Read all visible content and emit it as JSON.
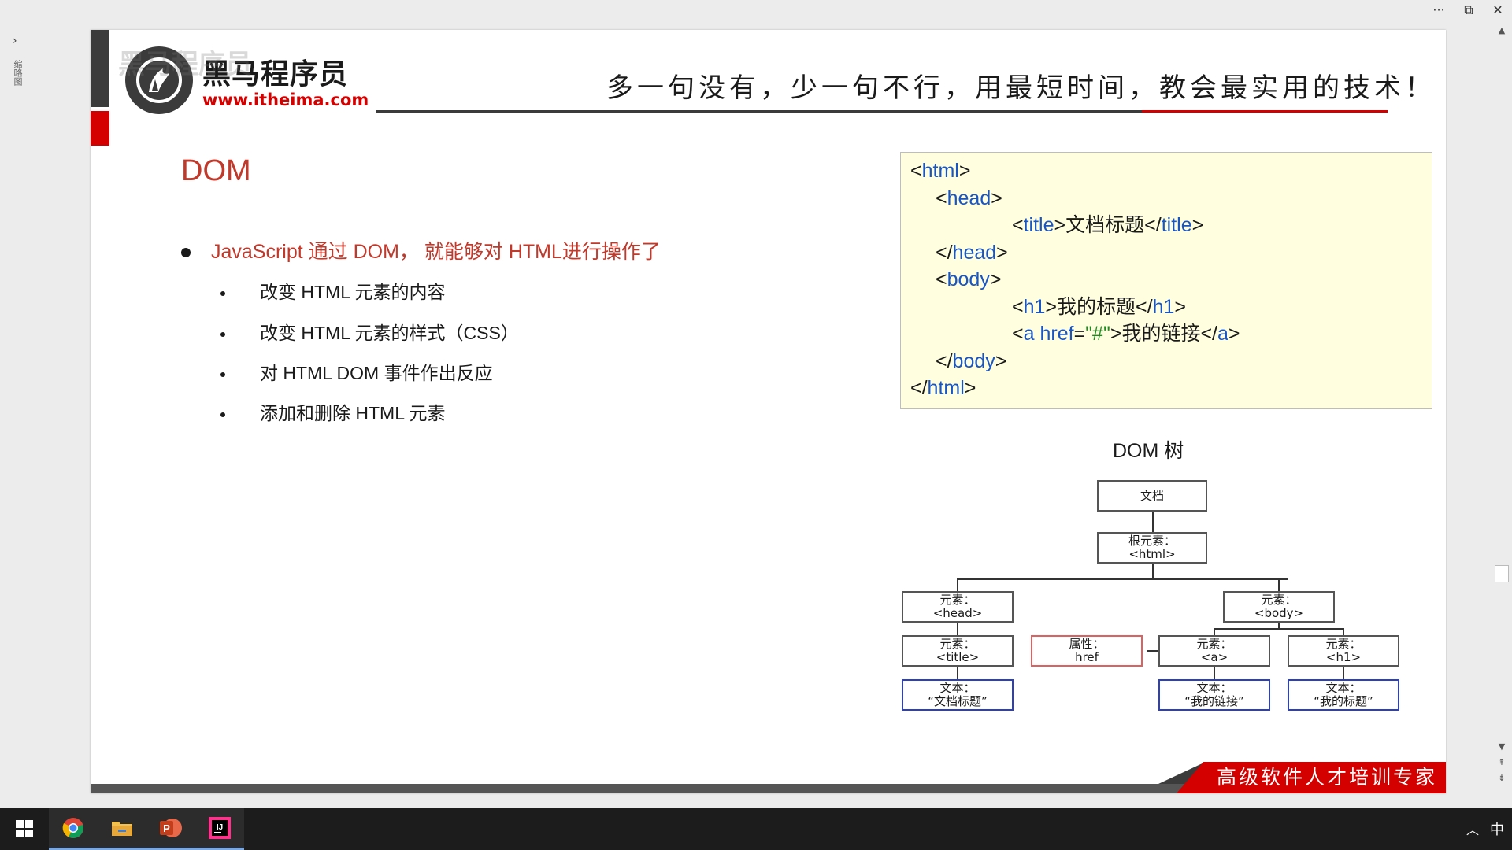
{
  "window": {
    "more_glyph": "···",
    "restore_glyph": "⧉",
    "close_glyph": "✕"
  },
  "left_panel": {
    "chevron": "›",
    "label": "缩略图"
  },
  "slide": {
    "logo": {
      "name": "黑马程序员",
      "url": "www.itheima.com"
    },
    "watermark": "黑马程序员",
    "slogan": "多一句没有，少一句不行，用最短时间，教会最实用的技术！",
    "title": "DOM",
    "main_bullet": "JavaScript 通过 DOM， 就能够对 HTML进行操作了",
    "sub_bullets": [
      "改变 HTML 元素的内容",
      "改变 HTML 元素的样式（CSS）",
      "对 HTML DOM 事件作出反应",
      "添加和删除 HTML 元素"
    ],
    "code": {
      "l1_tag": "html",
      "l2_tag": "head",
      "l3_tag": "title",
      "l3_text": "文档标题",
      "l4_tag": "head",
      "l5_tag": "body",
      "l6_tag": "h1",
      "l6_text": "我的标题",
      "l7_tag": "a",
      "l7_attr": "href",
      "l7_value": "\"#\"",
      "l7_text": "我的链接",
      "l8_tag": "body",
      "l9_tag": "html"
    },
    "tree_title": "DOM 树",
    "tree": {
      "document": "文档",
      "root_l1": "根元素：",
      "root_l2": "<html>",
      "head_l1": "元素：",
      "head_l2": "<head>",
      "body_l1": "元素：",
      "body_l2": "<body>",
      "title_l1": "元素：",
      "title_l2": "<title>",
      "attr_l1": "属性：",
      "attr_l2": "href",
      "a_l1": "元素：",
      "a_l2": "<a>",
      "h1_l1": "元素：",
      "h1_l2": "<h1>",
      "text1_l1": "文本：",
      "text1_l2": "“文档标题”",
      "text2_l1": "文本：",
      "text2_l2": "“我的链接”",
      "text3_l1": "文本：",
      "text3_l2": "“我的标题”"
    },
    "footer": "高级软件人才培训专家"
  },
  "scrollbar": {
    "up": "▲",
    "down": "▼",
    "prev": "⇞",
    "next": "⇟"
  },
  "taskbar": {
    "tray_arrow": "︿",
    "ime": "中",
    "ppt_letter": "P",
    "ij_letter": "IJ"
  },
  "colors": {
    "accent_red": "#d40000",
    "title_red": "#c0392b",
    "code_tag_blue": "#1a55c4",
    "code_string_green": "#1f8a1f",
    "code_bg": "#ffffe0"
  }
}
